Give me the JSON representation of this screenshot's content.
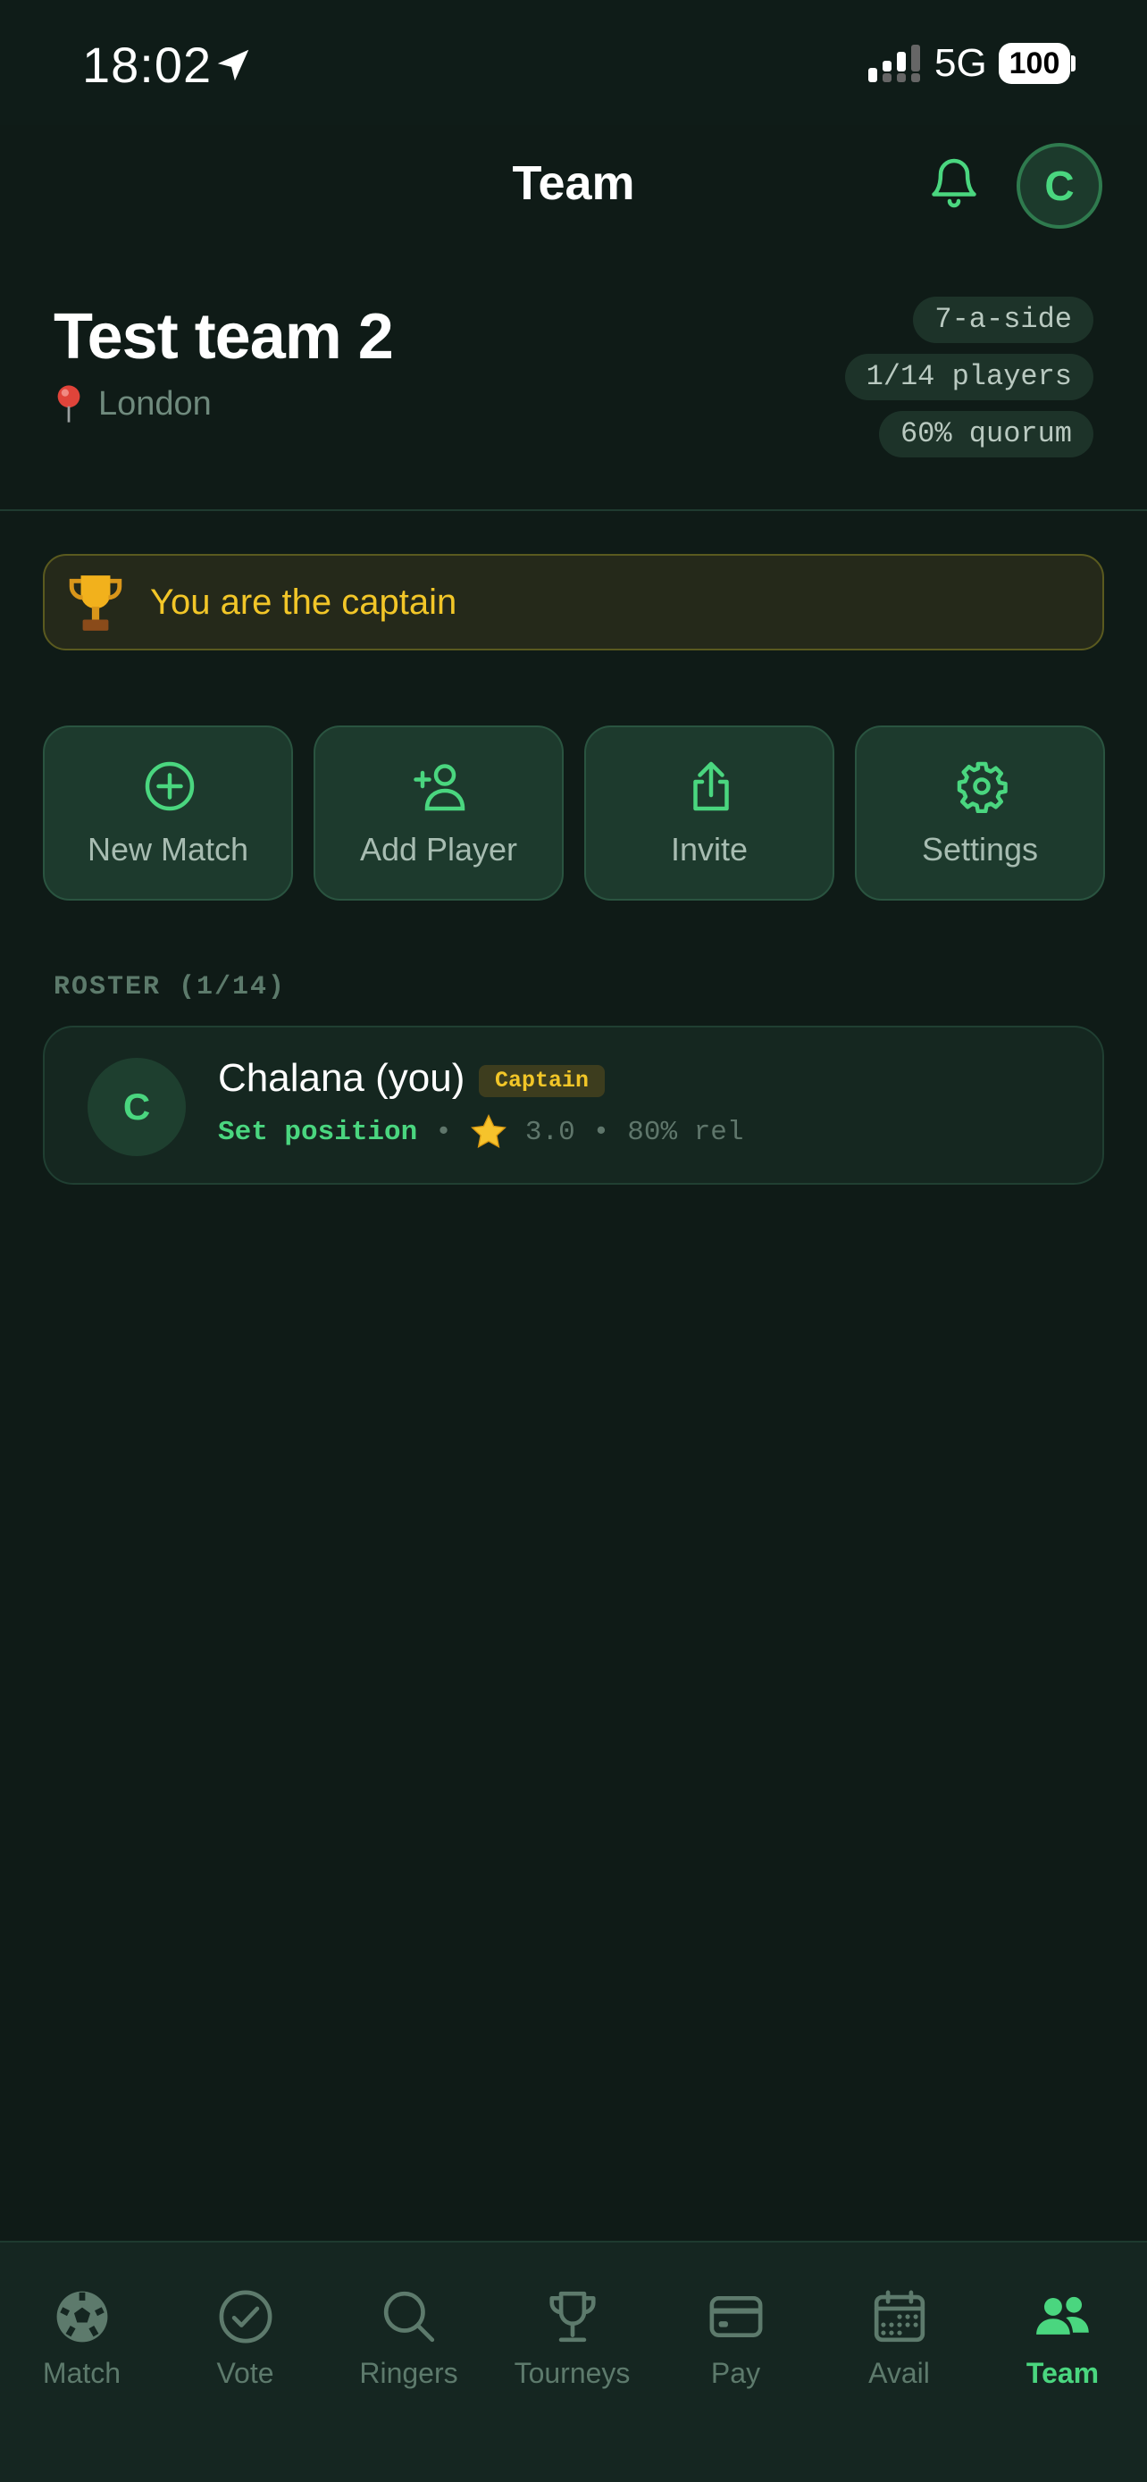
{
  "status_bar": {
    "time": "18:02",
    "network": "5G",
    "battery": "100"
  },
  "header": {
    "title": "Team",
    "avatar_initial": "C"
  },
  "team": {
    "name": "Test team 2",
    "location": "London",
    "pills": [
      "7-a-side",
      "1/14 players",
      "60% quorum"
    ]
  },
  "captain_banner": {
    "text": "You are the captain"
  },
  "actions": [
    {
      "label": "New Match",
      "icon": "plus-circle-icon"
    },
    {
      "label": "Add Player",
      "icon": "add-user-icon"
    },
    {
      "label": "Invite",
      "icon": "share-icon"
    },
    {
      "label": "Settings",
      "icon": "gear-icon"
    }
  ],
  "roster": {
    "heading": "ROSTER (1/14)",
    "players": [
      {
        "initial": "C",
        "name": "Chalana (you)",
        "badge": "Captain",
        "set_position": "Set position",
        "rating": "3.0",
        "reliability": "80% rel"
      }
    ]
  },
  "bottom_nav": {
    "items": [
      {
        "label": "Match",
        "icon": "soccer-ball-icon",
        "active": false
      },
      {
        "label": "Vote",
        "icon": "check-circle-icon",
        "active": false
      },
      {
        "label": "Ringers",
        "icon": "search-icon",
        "active": false
      },
      {
        "label": "Tourneys",
        "icon": "trophy-icon",
        "active": false
      },
      {
        "label": "Pay",
        "icon": "credit-card-icon",
        "active": false
      },
      {
        "label": "Avail",
        "icon": "calendar-icon",
        "active": false
      },
      {
        "label": "Team",
        "icon": "team-icon",
        "active": true
      }
    ]
  },
  "colors": {
    "accent": "#4ad67f",
    "captain": "#f2c628",
    "background": "#0f1b17"
  }
}
